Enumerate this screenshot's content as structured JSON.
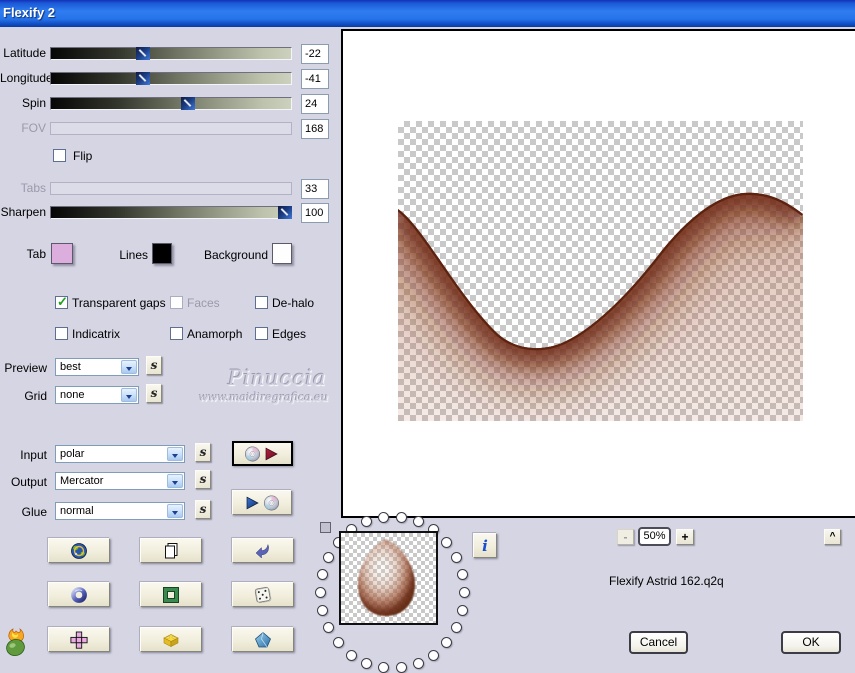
{
  "window": {
    "title": "Flexify 2"
  },
  "colors": {
    "dialog_bg": "#d5d5e3",
    "titlebar_blue": "#2f7df0",
    "wave_brown": "#5e2310",
    "check_green": "#1ea11e"
  },
  "sliders": [
    {
      "label": "Latitude",
      "value": "-22",
      "thumb_pct": 38.5,
      "disabled": false
    },
    {
      "label": "Longitude",
      "value": "-41",
      "thumb_pct": 38.5,
      "disabled": false
    },
    {
      "label": "Spin",
      "value": "24",
      "thumb_pct": 57,
      "disabled": false
    },
    {
      "label": "FOV",
      "value": "168",
      "thumb_pct": 0,
      "disabled": true
    },
    {
      "label": "Tabs",
      "value": "33",
      "thumb_pct": 0,
      "disabled": true
    },
    {
      "label": "Sharpen",
      "value": "100",
      "thumb_pct": 97.5,
      "disabled": false
    }
  ],
  "flip": {
    "label": "Flip",
    "glyph": ""
  },
  "swatches": [
    {
      "label": "Tab",
      "color": "#dcaede"
    },
    {
      "label": "Lines",
      "color": "#000000"
    },
    {
      "label": "Background",
      "color": "#fefefe"
    }
  ],
  "checkboxes": [
    {
      "label": "Transparent gaps",
      "glyph": "✓",
      "disabled": false
    },
    {
      "label": "Faces",
      "glyph": "",
      "disabled": true
    },
    {
      "label": "De-halo",
      "glyph": "",
      "disabled": false
    },
    {
      "label": "Indicatrix",
      "glyph": "",
      "disabled": false
    },
    {
      "label": "Anamorph",
      "glyph": "",
      "disabled": false
    },
    {
      "label": "Edges",
      "glyph": "",
      "disabled": false
    }
  ],
  "selects": [
    {
      "label": "Preview",
      "value": "best"
    },
    {
      "label": "Grid",
      "value": "none"
    },
    {
      "label": "Input",
      "value": "polar"
    },
    {
      "label": "Output",
      "value": "Mercator"
    },
    {
      "label": "Glue",
      "value": "normal"
    }
  ],
  "s_button_glyph": "s",
  "watermark": {
    "line1": "Pinuccia",
    "line2": "www.maidiregrafica.eu"
  },
  "info_button_glyph": "i",
  "zoom_controls": {
    "minus": "-",
    "level": "50%",
    "plus": "+",
    "expand": "^"
  },
  "preset_name": "Flexify Astrid 162.q2q",
  "dialog_buttons": {
    "cancel": "Cancel",
    "ok": "OK"
  },
  "dial": {
    "dot_count": 26
  }
}
